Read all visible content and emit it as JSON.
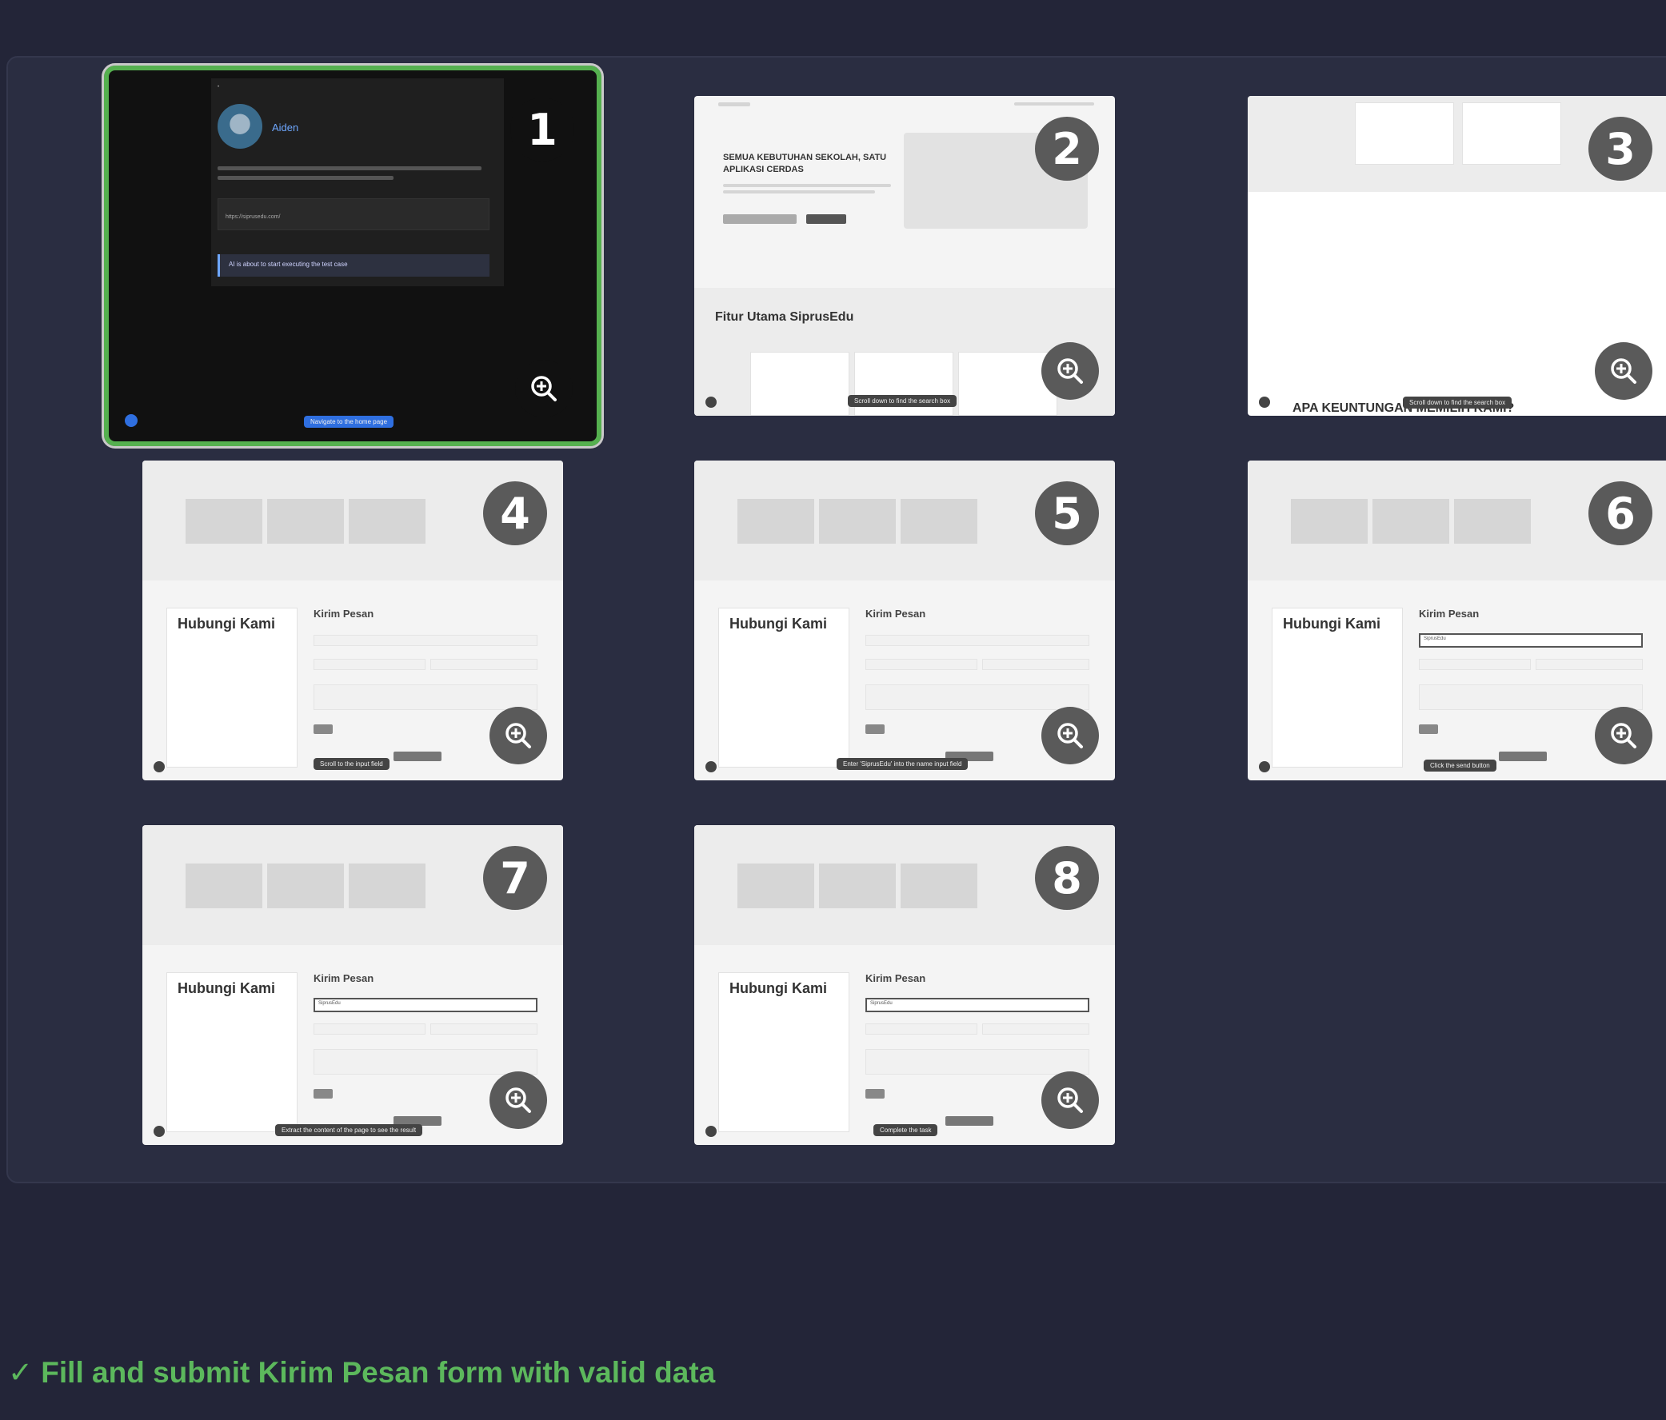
{
  "gallery": {
    "thumbnails": [
      {
        "number": "1",
        "tooltip": "Navigate to the home page",
        "user_label": "Aiden",
        "url_value": "https://siprusedu.com/",
        "notice": "AI is about to start executing the test case"
      },
      {
        "number": "2",
        "tooltip": "Scroll down to find the search box",
        "hero_title": "SEMUA KEBUTUHAN SEKOLAH, SATU APLIKASI CERDAS",
        "section_title": "Fitur Utama SiprusEdu"
      },
      {
        "number": "3",
        "tooltip": "Scroll down to find the search box",
        "section_title": "APA KEUNTUNGAN MEMILIH KAMI?"
      },
      {
        "number": "4",
        "tooltip": "Scroll to the input field",
        "contact_title": "Hubungi Kami",
        "form_title": "Kirim Pesan"
      },
      {
        "number": "5",
        "tooltip": "Enter 'SiprusEdu' into the name input field",
        "contact_title": "Hubungi Kami",
        "form_title": "Kirim Pesan"
      },
      {
        "number": "6",
        "tooltip": "Click the send button",
        "contact_title": "Hubungi Kami",
        "form_title": "Kirim Pesan",
        "name_value": "SiprusEdu"
      },
      {
        "number": "7",
        "tooltip": "Extract the content of the page to see the result",
        "contact_title": "Hubungi Kami",
        "form_title": "Kirim Pesan",
        "name_value": "SiprusEdu"
      },
      {
        "number": "8",
        "tooltip": "Complete the task",
        "contact_title": "Hubungi Kami",
        "form_title": "Kirim Pesan",
        "name_value": "SiprusEdu"
      }
    ]
  },
  "status": {
    "check": "✓",
    "text": "Fill and submit Kirim Pesan form with valid data",
    "color": "#5cb85c"
  },
  "icons": {
    "zoom": "zoom-in-icon"
  }
}
